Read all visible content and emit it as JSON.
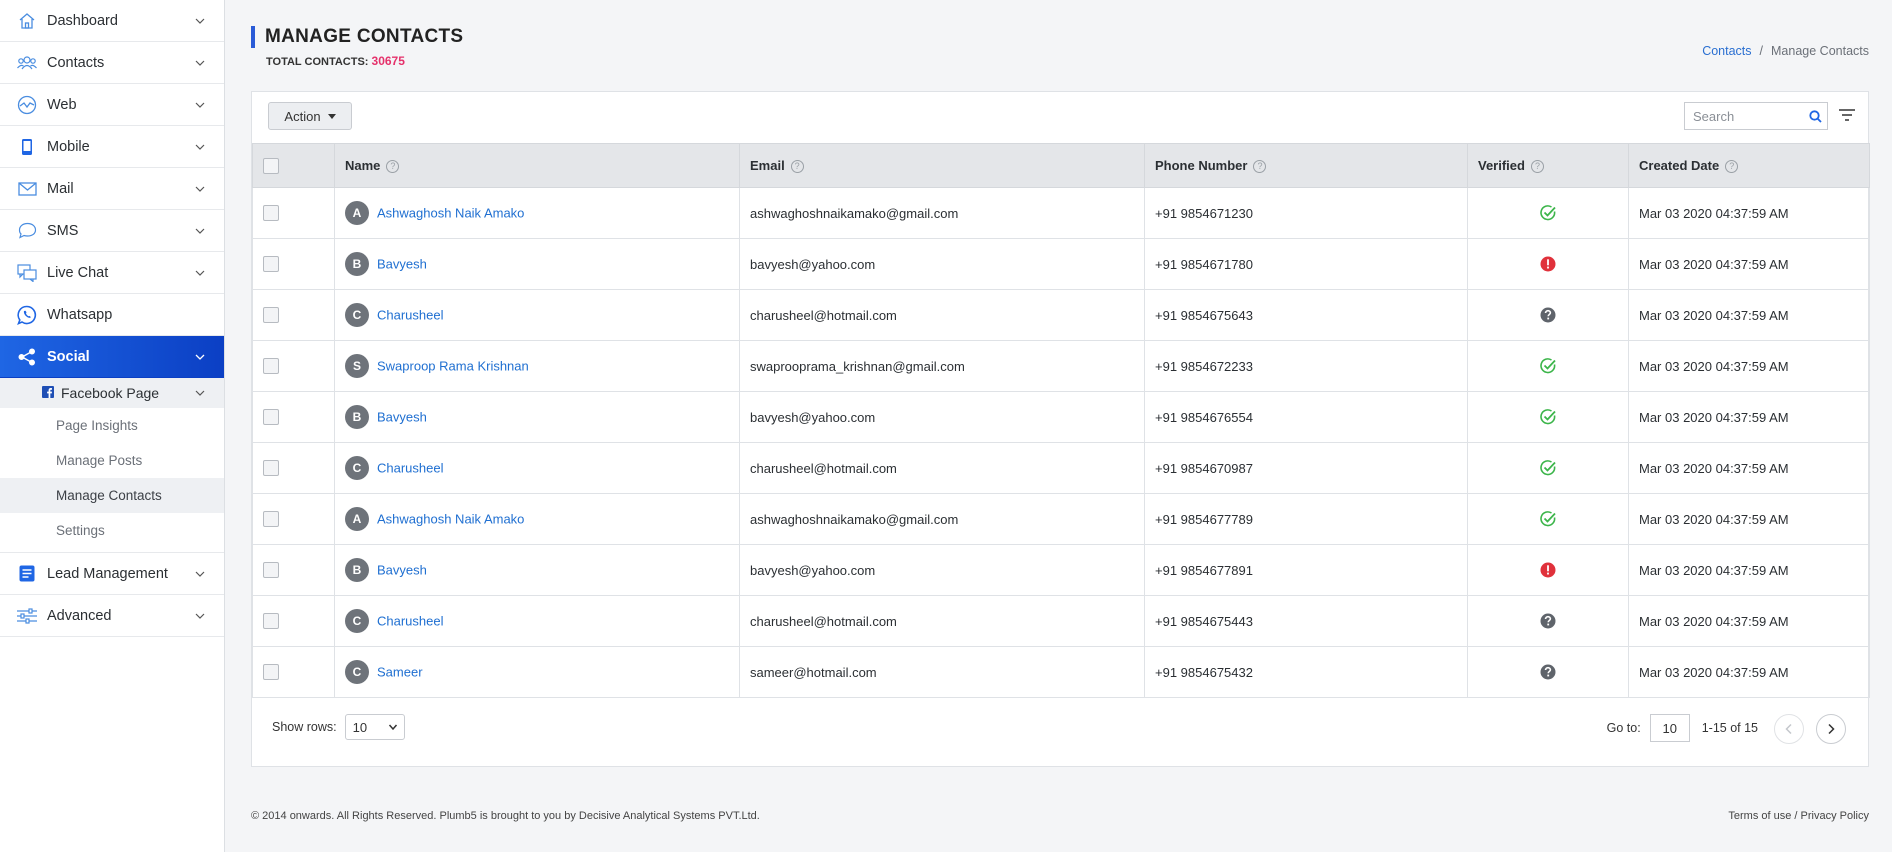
{
  "sidebar": {
    "items": [
      {
        "label": "Dashboard",
        "icon": "home-icon"
      },
      {
        "label": "Contacts",
        "icon": "users-icon"
      },
      {
        "label": "Web",
        "icon": "web-icon"
      },
      {
        "label": "Mobile",
        "icon": "mobile-icon"
      },
      {
        "label": "Mail",
        "icon": "mail-icon"
      },
      {
        "label": "SMS",
        "icon": "sms-icon"
      },
      {
        "label": "Live Chat",
        "icon": "live-chat-icon"
      },
      {
        "label": "Whatsapp",
        "icon": "whatsapp-icon"
      },
      {
        "label": "Social",
        "icon": "share-icon"
      },
      {
        "label": "Lead Management",
        "icon": "lead-icon"
      },
      {
        "label": "Advanced",
        "icon": "sliders-icon"
      }
    ],
    "submenu": {
      "label": "Facebook Page",
      "icon": "facebook-icon"
    },
    "leaves": [
      "Page Insights",
      "Manage Posts",
      "Manage Contacts",
      "Settings"
    ]
  },
  "header": {
    "title": "MANAGE CONTACTS",
    "total_label": "TOTAL CONTACTS:",
    "total_count": "30675"
  },
  "breadcrumb": {
    "link": "Contacts",
    "separator": "/",
    "current": "Manage Contacts"
  },
  "toolbar": {
    "action_label": "Action",
    "search_placeholder": "Search"
  },
  "table": {
    "columns": [
      "Name",
      "Email",
      "Phone Number",
      "Verified",
      "Created Date"
    ],
    "rows": [
      {
        "initial": "A",
        "name": "Ashwaghosh Naik Amako",
        "email": "ashwaghoshnaikamako@gmail.com",
        "phone": "+91 9854671230",
        "verified": "verified",
        "created": "Mar 03 2020 04:37:59 AM"
      },
      {
        "initial": "B",
        "name": "Bavyesh",
        "email": "bavyesh@yahoo.com",
        "phone": "+91 9854671780",
        "verified": "error",
        "created": "Mar 03 2020 04:37:59 AM"
      },
      {
        "initial": "C",
        "name": "Charusheel",
        "email": "charusheel@hotmail.com",
        "phone": "+91 9854675643",
        "verified": "unknown",
        "created": "Mar 03 2020 04:37:59 AM"
      },
      {
        "initial": "S",
        "name": "Swaproop Rama Krishnan",
        "email": "swaprooprama_krishnan@gmail.com",
        "phone": "+91 9854672233",
        "verified": "verified",
        "created": "Mar 03 2020 04:37:59 AM"
      },
      {
        "initial": "B",
        "name": "Bavyesh",
        "email": "bavyesh@yahoo.com",
        "phone": "+91 9854676554",
        "verified": "verified",
        "created": "Mar 03 2020 04:37:59 AM"
      },
      {
        "initial": "C",
        "name": "Charusheel",
        "email": "charusheel@hotmail.com",
        "phone": "+91 9854670987",
        "verified": "verified",
        "created": "Mar 03 2020 04:37:59 AM"
      },
      {
        "initial": "A",
        "name": "Ashwaghosh Naik Amako",
        "email": "ashwaghoshnaikamako@gmail.com",
        "phone": "+91 9854677789",
        "verified": "verified",
        "created": "Mar 03 2020 04:37:59 AM"
      },
      {
        "initial": "B",
        "name": "Bavyesh",
        "email": "bavyesh@yahoo.com",
        "phone": "+91 9854677891",
        "verified": "error",
        "created": "Mar 03 2020 04:37:59 AM"
      },
      {
        "initial": "C",
        "name": "Charusheel",
        "email": "charusheel@hotmail.com",
        "phone": "+91 9854675443",
        "verified": "unknown",
        "created": "Mar 03 2020 04:37:59 AM"
      },
      {
        "initial": "C",
        "name": "Sameer",
        "email": "sameer@hotmail.com",
        "phone": "+91 9854675432",
        "verified": "unknown",
        "created": "Mar 03 2020 04:37:59 AM"
      }
    ]
  },
  "pagination": {
    "show_rows_label": "Show rows:",
    "rows_value": "10",
    "goto_label": "Go to:",
    "goto_value": "10",
    "range": "1-15 of 15"
  },
  "footer": {
    "copyright": "© 2014 onwards. All Rights Reserved. Plumb5 is brought to you by Decisive Analytical Systems PVT.Ltd.",
    "links": "Terms of use / Privacy Policy"
  },
  "colors": {
    "accent": "#1f66e4",
    "link": "#1f6fd1",
    "count": "#e5316b",
    "verified": "#3cb54a",
    "error": "#e0313b",
    "unknown": "#5f646b"
  }
}
